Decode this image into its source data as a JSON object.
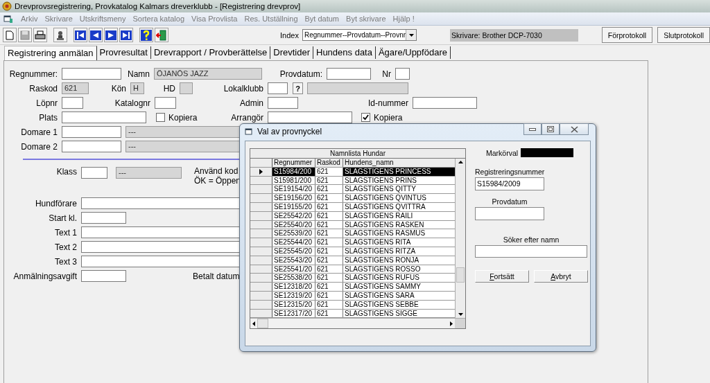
{
  "window": {
    "title": "Drevprovsregistrering, Provkatalog  Kalmars dreverklubb - [Registrering drevprov]"
  },
  "menu": [
    "Arkiv",
    "Skrivare",
    "Utskriftsmeny",
    "Sortera katalog",
    "Visa Provlista",
    "Res. Utställning",
    "Byt datum",
    "Byt skrivare",
    "Hjälp !"
  ],
  "toolbar": {
    "index_label": "Index",
    "index_value": "Regnummer--Provdatum--Provnr",
    "printer": "Skrivare: Brother DCP-7030",
    "buttons": [
      "Förprotokoll",
      "Slutprotokoll"
    ]
  },
  "tabs": [
    {
      "label": "Registrering anmälan",
      "selected": true
    },
    {
      "label": "Provresultat",
      "selected": false
    },
    {
      "label": "Drevrapport / Provberättelse",
      "selected": false
    },
    {
      "label": "Drevtider",
      "selected": false
    },
    {
      "label": "Hundens data",
      "selected": false
    },
    {
      "label": "Ägare/Uppfödare",
      "selected": false
    }
  ],
  "form": {
    "regnummer": {
      "kind": "field",
      "label": "Regnummer:",
      "disabled": false
    },
    "namn": {
      "kind": "field",
      "label": "Namn",
      "value": "ÖJANÖS JAZZ",
      "disabled": true
    },
    "provdatum": {
      "kind": "field",
      "label": "Provdatum:",
      "disabled": false
    },
    "nr": {
      "kind": "field",
      "label": "Nr",
      "disabled": false
    },
    "raskod": {
      "kind": "field",
      "label": "Raskod",
      "value": "621",
      "disabled": true
    },
    "kon": {
      "kind": "field",
      "label": "Kön",
      "value": "H",
      "disabled": true
    },
    "hd": {
      "kind": "field",
      "label": "HD",
      "disabled": true
    },
    "lokalklubb": {
      "kind": "field",
      "label": "Lokalklubb",
      "disabled": false
    },
    "lokalklubb_lookup": {
      "kind": "button",
      "label": "?"
    },
    "lokalklubb_name": {
      "kind": "field",
      "disabled": true
    },
    "lopnr": {
      "kind": "field",
      "label": "Löpnr",
      "disabled": false
    },
    "katalognr": {
      "kind": "field",
      "label": "Katalognr",
      "disabled": false
    },
    "admin": {
      "kind": "field",
      "label": "Admin",
      "disabled": false
    },
    "id_nummer": {
      "kind": "field",
      "label": "Id-nummer",
      "disabled": false
    },
    "plats": {
      "kind": "field",
      "label": "Plats",
      "disabled": false
    },
    "plats_kopiera": {
      "kind": "checkbox",
      "label": "Kopiera",
      "checked": false
    },
    "arrangor": {
      "kind": "field",
      "label": "Arrangör",
      "disabled": false
    },
    "arrangor_kopiera": {
      "kind": "checkbox",
      "label": "Kopiera",
      "checked": true
    },
    "domare_1": {
      "kind": "field",
      "label": "Domare 1",
      "disabled": false
    },
    "domare_1_name": {
      "kind": "field",
      "value": "---",
      "disabled": true
    },
    "domare_2": {
      "kind": "field",
      "label": "Domare 2",
      "disabled": false
    },
    "domare_2_name": {
      "kind": "field",
      "value": "---",
      "disabled": true
    },
    "klass": {
      "kind": "field",
      "label": "Klass",
      "disabled": false
    },
    "klass_name": {
      "kind": "field",
      "value": "---",
      "disabled": true
    },
    "klass_hint": {
      "kind": "note",
      "lines": [
        "Använd kod",
        "ÖK = Öppen"
      ]
    },
    "hundforare": {
      "kind": "field",
      "label": "Hundförare",
      "disabled": false
    },
    "start_kl": {
      "kind": "field",
      "label": "Start kl.",
      "disabled": false
    },
    "text_1": {
      "kind": "field",
      "label": "Text 1",
      "disabled": false
    },
    "text_2": {
      "kind": "field",
      "label": "Text 2",
      "disabled": false
    },
    "text_3": {
      "kind": "field",
      "label": "Text 3",
      "disabled": false
    },
    "anmalningsavgift": {
      "kind": "field",
      "label": "Anmälningsavgift",
      "disabled": false
    },
    "betalt_datum": {
      "kind": "note",
      "lines": [
        "Betalt datum"
      ]
    }
  },
  "dialog": {
    "title": "Val  av provnyckel",
    "grid": {
      "caption": "Namnlista Hundar",
      "columns": [
        "Regnummer",
        "Raskod",
        "Hundens_namn"
      ],
      "rows": [
        {
          "regnummer": "S15984/200",
          "raskod": "621",
          "namn": "SLAGSTIGENS PRINCESS",
          "selected": true
        },
        {
          "regnummer": "S15981/200",
          "raskod": "621",
          "namn": "SLAGSTIGENS PRINS",
          "selected": false
        },
        {
          "regnummer": "SE19154/20",
          "raskod": "621",
          "namn": "SLAGSTIGENS QITTY",
          "selected": false
        },
        {
          "regnummer": "SE19156/20",
          "raskod": "621",
          "namn": "SLAGSTIGENS QVINTUS",
          "selected": false
        },
        {
          "regnummer": "SE19155/20",
          "raskod": "621",
          "namn": "SLAGSTIGENS QVITTRA",
          "selected": false
        },
        {
          "regnummer": "SE25542/20",
          "raskod": "621",
          "namn": "SLAGSTIGENS RAILI",
          "selected": false
        },
        {
          "regnummer": "SE25540/20",
          "raskod": "621",
          "namn": "SLAGSTIGENS RASKEN",
          "selected": false
        },
        {
          "regnummer": "SE25539/20",
          "raskod": "621",
          "namn": "SLAGSTIGENS RASMUS",
          "selected": false
        },
        {
          "regnummer": "SE25544/20",
          "raskod": "621",
          "namn": "SLAGSTIGENS RITA",
          "selected": false
        },
        {
          "regnummer": "SE25545/20",
          "raskod": "621",
          "namn": "SLAGSTIGENS RITZA",
          "selected": false
        },
        {
          "regnummer": "SE25543/20",
          "raskod": "621",
          "namn": "SLAGSTIGENS RONJA",
          "selected": false
        },
        {
          "regnummer": "SE25541/20",
          "raskod": "621",
          "namn": "SLAGSTIGENS ROSSO",
          "selected": false
        },
        {
          "regnummer": "SE25538/20",
          "raskod": "621",
          "namn": "SLAGSTIGENS RUFUS",
          "selected": false
        },
        {
          "regnummer": "SE12318/20",
          "raskod": "621",
          "namn": "SLAGSTIGENS SAMMY",
          "selected": false
        },
        {
          "regnummer": "SE12319/20",
          "raskod": "621",
          "namn": "SLAGSTIGENS SARA",
          "selected": false
        },
        {
          "regnummer": "SE12315/20",
          "raskod": "621",
          "namn": "SLAGSTIGENS SEBBE",
          "selected": false
        },
        {
          "regnummer": "SE12317/20",
          "raskod": "621",
          "namn": "SLAGSTIGENS SIGGE",
          "selected": false
        }
      ]
    },
    "markorval_label": "Markörval",
    "regnr": {
      "label": "Registreringsnummer",
      "value": "S15984/2009"
    },
    "provdatum": {
      "label": "Provdatum"
    },
    "search": {
      "label": "Söker efter namn"
    },
    "buttons": [
      "Fortsätt",
      "Avbryt"
    ]
  }
}
